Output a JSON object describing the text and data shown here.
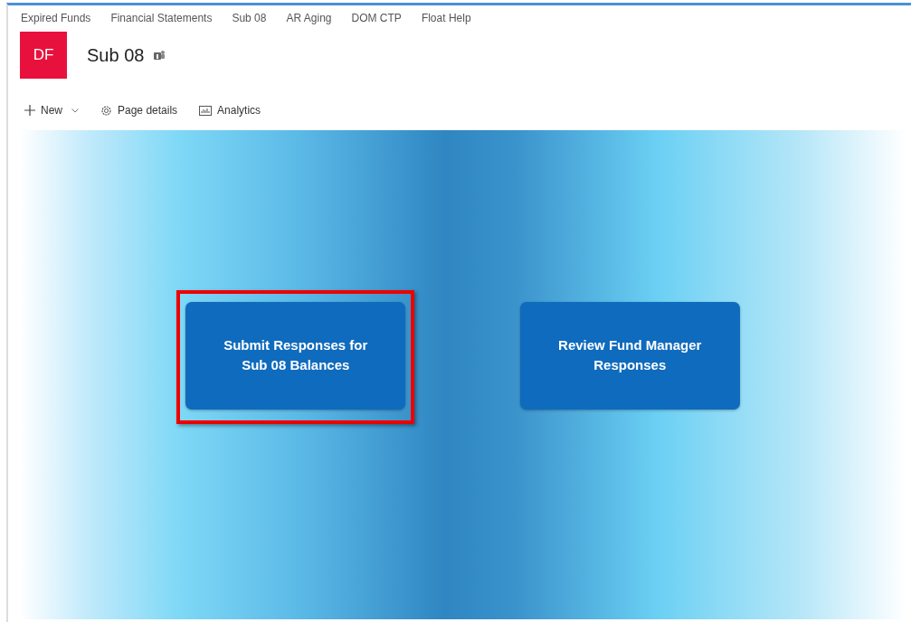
{
  "top_nav": [
    {
      "label": "Expired Funds"
    },
    {
      "label": "Financial Statements"
    },
    {
      "label": "Sub 08"
    },
    {
      "label": "AR Aging"
    },
    {
      "label": "DOM CTP"
    },
    {
      "label": "Float Help"
    }
  ],
  "site": {
    "logo": "DF",
    "title": "Sub 08"
  },
  "command_bar": [
    {
      "kind": "new",
      "label": "New"
    },
    {
      "kind": "details",
      "label": "Page details"
    },
    {
      "kind": "analytics",
      "label": "Analytics"
    }
  ],
  "tiles": [
    {
      "label": "Submit Responses for Sub 08 Balances",
      "highlighted": true
    },
    {
      "label": "Review Fund Manager Responses",
      "highlighted": false
    }
  ]
}
